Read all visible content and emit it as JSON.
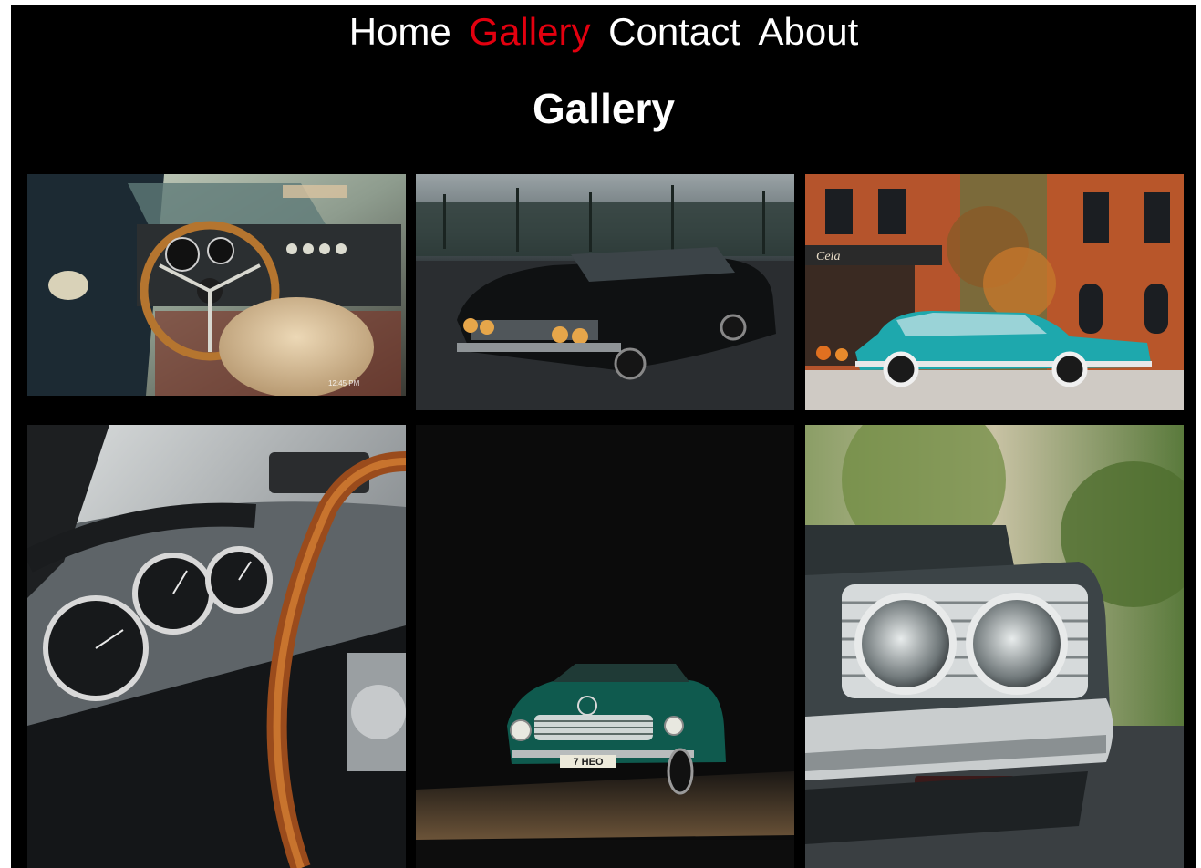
{
  "nav": {
    "items": [
      {
        "label": "Home",
        "active": false
      },
      {
        "label": "Gallery",
        "active": true
      },
      {
        "label": "Contact",
        "active": false
      },
      {
        "label": "About",
        "active": false
      }
    ],
    "active_color": "#e3000f",
    "text_color": "#ffffff"
  },
  "page": {
    "title": "Gallery",
    "background": "#000000"
  },
  "gallery": {
    "photos": [
      {
        "subject": "classic-car-interior-wood-steering-wheel",
        "overlay_time": "12:45 PM"
      },
      {
        "subject": "black-vintage-sedan-night-parking-lot"
      },
      {
        "subject": "turquoise-vintage-car-brick-buildings",
        "sign_text": "Ceia"
      },
      {
        "subject": "vintage-dashboard-gauges-wood-wheel"
      },
      {
        "subject": "green-mercedes-convertible-dark",
        "plate_text": "7 HEO"
      },
      {
        "subject": "chrome-front-double-headlights"
      }
    ]
  }
}
